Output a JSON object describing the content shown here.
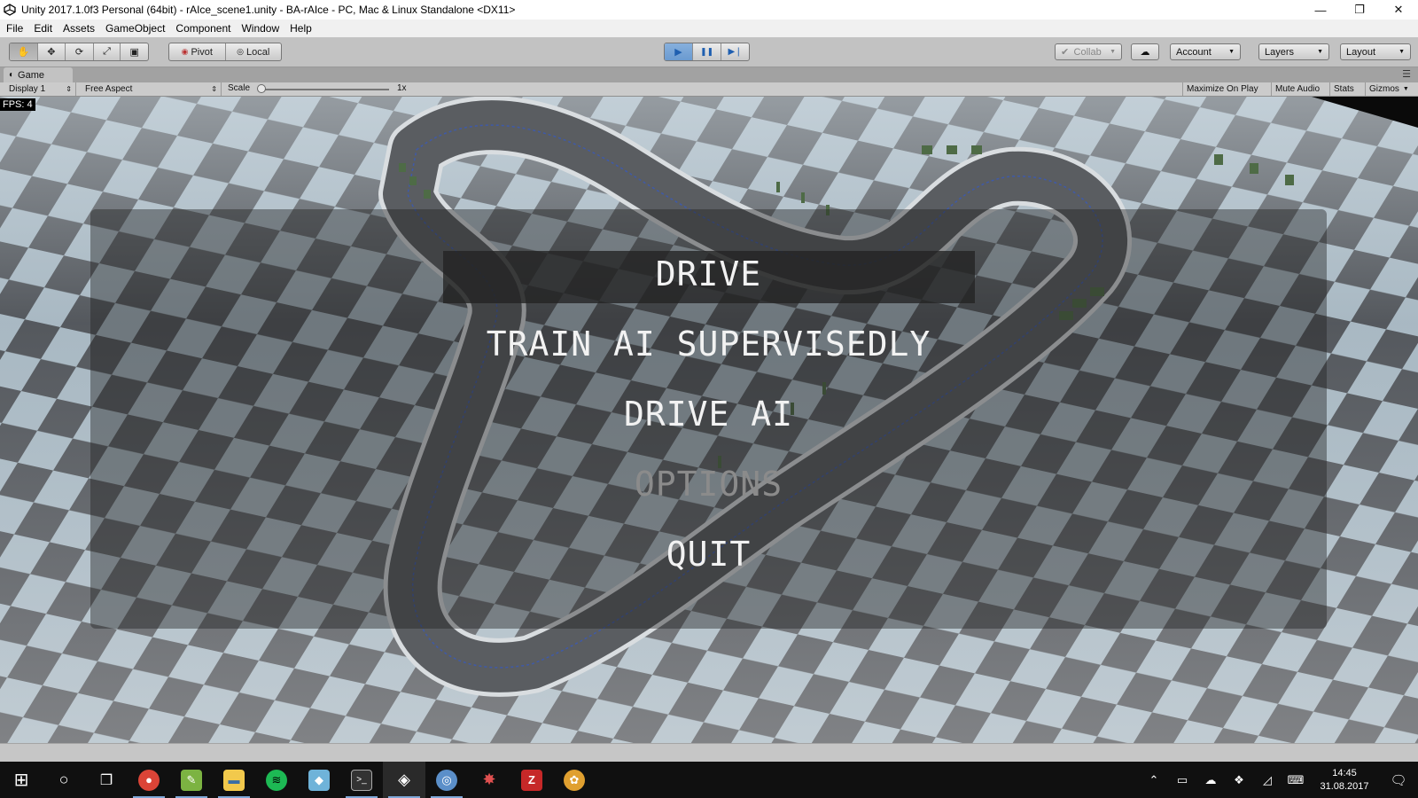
{
  "window": {
    "title": "Unity 2017.1.0f3 Personal (64bit) - rAIce_scene1.unity - BA-rAIce - PC, Mac & Linux Standalone <DX11>",
    "minimize_glyph": "—",
    "restore_glyph": "❐",
    "close_glyph": "✕"
  },
  "menubar": {
    "items": [
      "File",
      "Edit",
      "Assets",
      "GameObject",
      "Component",
      "Window",
      "Help"
    ]
  },
  "toolbar": {
    "tools": [
      {
        "name": "hand-tool",
        "glyph": "✋"
      },
      {
        "name": "move-tool",
        "glyph": "✥"
      },
      {
        "name": "rotate-tool",
        "glyph": "⟳"
      },
      {
        "name": "scale-tool",
        "glyph": "⤢"
      },
      {
        "name": "rect-tool",
        "glyph": "▣"
      }
    ],
    "pivot_label": "Pivot",
    "local_label": "Local",
    "play_glyph": "▶",
    "pause_glyph": "❚❚",
    "step_glyph": "▶❘",
    "collab_label": "Collab",
    "cloud_glyph": "☁",
    "account_label": "Account",
    "layers_label": "Layers",
    "layout_label": "Layout",
    "accent_active": "#6a9ad0"
  },
  "game_view": {
    "tab_label": "Game",
    "display_label": "Display 1",
    "aspect_label": "Free Aspect",
    "scale_label": "Scale",
    "scale_value": "1x",
    "maximize_label": "Maximize On Play",
    "mute_label": "Mute Audio",
    "stats_label": "Stats",
    "gizmos_label": "Gizmos",
    "fps_label": "FPS: 4"
  },
  "game_menu": {
    "options": [
      "DRIVE",
      "TRAIN AI SUPERVISEDLY",
      "DRIVE AI",
      "OPTIONS",
      "QUIT"
    ],
    "selected_index": 0,
    "disabled_index": 3
  },
  "taskbar": {
    "apps": [
      {
        "name": "start-button",
        "glyph": "⊞",
        "color": "transparent"
      },
      {
        "name": "search-button",
        "glyph": "○",
        "color": "transparent"
      },
      {
        "name": "task-view-button",
        "glyph": "❐",
        "color": "transparent"
      },
      {
        "name": "chrome-icon",
        "glyph": "●",
        "color": "#db4437"
      },
      {
        "name": "notepad-plus-icon",
        "glyph": "✎",
        "color": "#7cb342"
      },
      {
        "name": "file-explorer-icon",
        "glyph": "▬",
        "color": "#f2c94c"
      },
      {
        "name": "spotify-icon",
        "glyph": "≋",
        "color": "#1db954"
      },
      {
        "name": "notes-app-icon",
        "glyph": "◆",
        "color": "#6fb3d9"
      },
      {
        "name": "terminal-icon",
        "glyph": ">_",
        "color": "#333333"
      },
      {
        "name": "unity-icon",
        "glyph": "◈",
        "color": "#222222"
      },
      {
        "name": "python-app-icon",
        "glyph": "◎",
        "color": "#5b8fc9"
      },
      {
        "name": "gear-app-icon",
        "glyph": "✸",
        "color": "#b03030"
      },
      {
        "name": "red-app-icon",
        "glyph": "Z",
        "color": "#c62828"
      },
      {
        "name": "paint-icon",
        "glyph": "✿",
        "color": "#e0a030"
      }
    ],
    "tray": [
      {
        "name": "show-hidden-icons",
        "glyph": "⌃"
      },
      {
        "name": "battery-icon",
        "glyph": "▭"
      },
      {
        "name": "onedrive-icon",
        "glyph": "☁"
      },
      {
        "name": "dropbox-icon",
        "glyph": "❖"
      },
      {
        "name": "wifi-icon",
        "glyph": "◿"
      },
      {
        "name": "keyboard-icon",
        "glyph": "⌨"
      }
    ],
    "time": "14:45",
    "date": "31.08.2017",
    "notification_glyph": "🗨"
  }
}
